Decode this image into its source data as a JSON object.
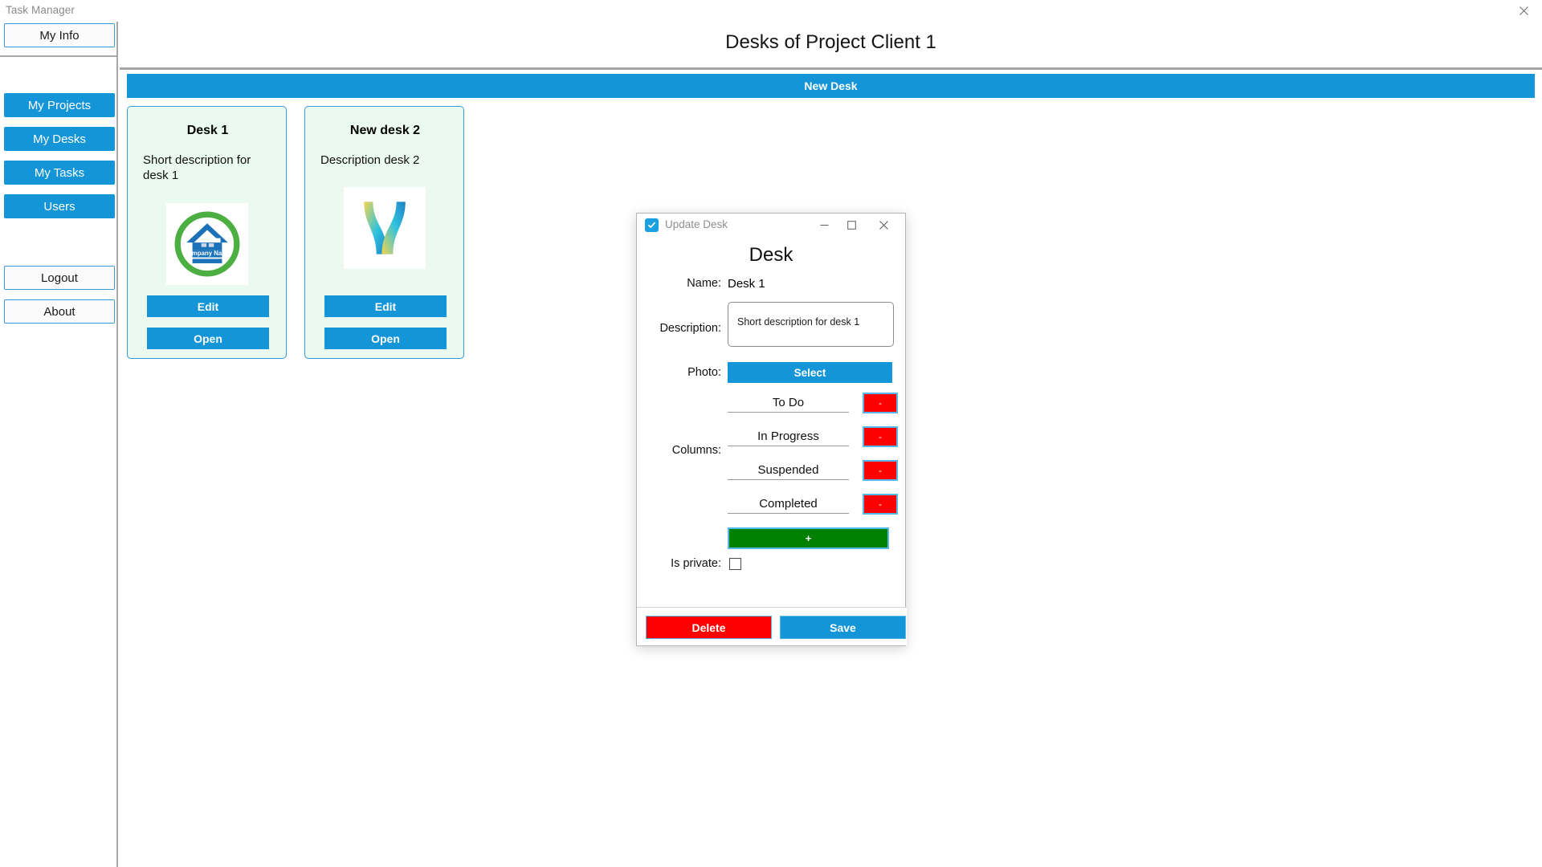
{
  "window": {
    "title": "Task Manager",
    "close_icon": "close-icon"
  },
  "sidebar": {
    "items": [
      {
        "label": "My Info",
        "style": "light"
      },
      {
        "label": "My Projects",
        "style": "blue"
      },
      {
        "label": "My Desks",
        "style": "blue"
      },
      {
        "label": "My Tasks",
        "style": "blue"
      },
      {
        "label": "Users",
        "style": "blue"
      },
      {
        "label": "Logout",
        "style": "light"
      },
      {
        "label": "About",
        "style": "light"
      }
    ]
  },
  "content": {
    "page_title": "Desks of Project Client 1",
    "new_desk_label": "New Desk",
    "cards": [
      {
        "name": "Desk 1",
        "description": "Short description for desk 1",
        "logo": "company-name-house-logo",
        "edit_label": "Edit",
        "open_label": "Open"
      },
      {
        "name": "New desk 2",
        "description": "Description desk 2",
        "logo": "x-ribbon-logo",
        "edit_label": "Edit",
        "open_label": "Open"
      }
    ]
  },
  "dialog": {
    "titlebar": {
      "app_icon": "checkmark-app-icon",
      "title": "Update Desk",
      "minimize_icon": "minimize-icon",
      "maximize_icon": "maximize-icon",
      "close_icon": "close-icon"
    },
    "heading": "Desk",
    "name_label": "Name:",
    "name_value": "Desk 1",
    "description_label": "Description:",
    "description_value": "Short description for desk 1",
    "photo_label": "Photo:",
    "photo_button": "Select",
    "columns_label": "Columns:",
    "columns": [
      {
        "value": "To Do",
        "remove_label": "-"
      },
      {
        "value": "In Progress",
        "remove_label": "-"
      },
      {
        "value": "Suspended",
        "remove_label": "-"
      },
      {
        "value": "Completed",
        "remove_label": "-"
      }
    ],
    "add_column_label": "+",
    "is_private_label": "Is private:",
    "is_private_checked": false,
    "delete_label": "Delete",
    "save_label": "Save"
  },
  "colors": {
    "accent_blue": "#1395d8",
    "border_blue": "#3b99d8",
    "card_green": "#eafaf0",
    "danger_red": "#fd0000",
    "success_green": "#008000"
  }
}
